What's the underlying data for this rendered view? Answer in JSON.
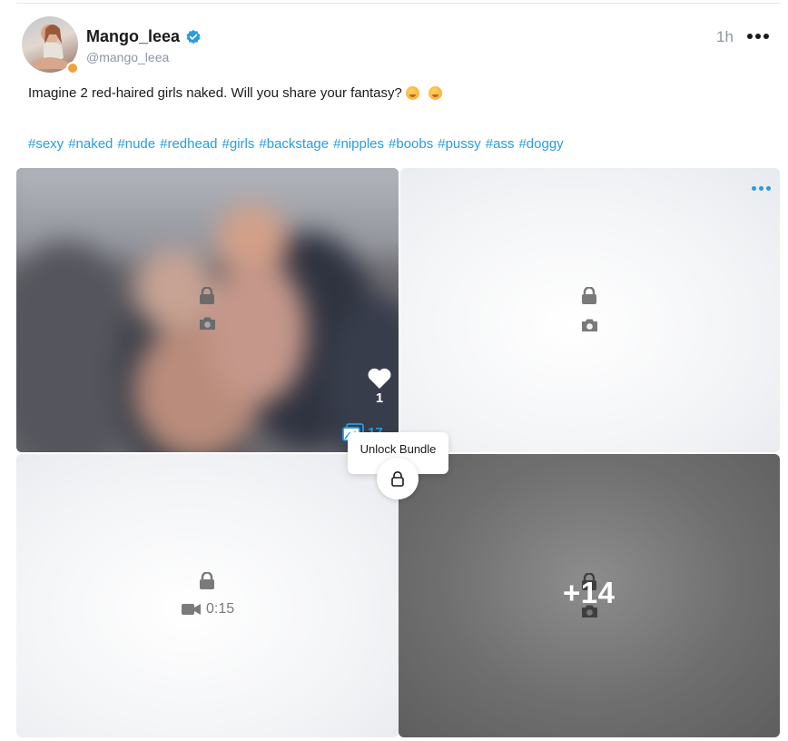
{
  "post": {
    "author": {
      "display_name": "Mango_leea",
      "handle": "@mango_leea",
      "verified": true,
      "online_status_color": "#f1a33b"
    },
    "time_ago": "1h",
    "caption": "Imagine 2 red-haired girls naked. Will you share your fantasy?",
    "caption_emojis": [
      "drooling-face-emoji",
      "face-with-hand-over-mouth-emoji"
    ],
    "hashtags": [
      "#sexy",
      "#naked",
      "#nude",
      "#redhead",
      "#girls",
      "#backstage",
      "#nipples",
      "#boobs",
      "#pussy",
      "#ass",
      "#doggy"
    ],
    "media": {
      "tiles": [
        {
          "type": "photo",
          "state": "locked-blurred-preview"
        },
        {
          "type": "photo",
          "state": "locked"
        },
        {
          "type": "video",
          "state": "locked",
          "duration": "0:15"
        },
        {
          "type": "photo",
          "state": "locked",
          "overlay": "+14"
        }
      ],
      "likes": "1",
      "media_count": "17",
      "tooltip": "Unlock Bundle"
    }
  },
  "colors": {
    "accent": "#2a9bdf",
    "muted_text": "#8a96a3",
    "icon_grey": "#7a7a7a"
  }
}
